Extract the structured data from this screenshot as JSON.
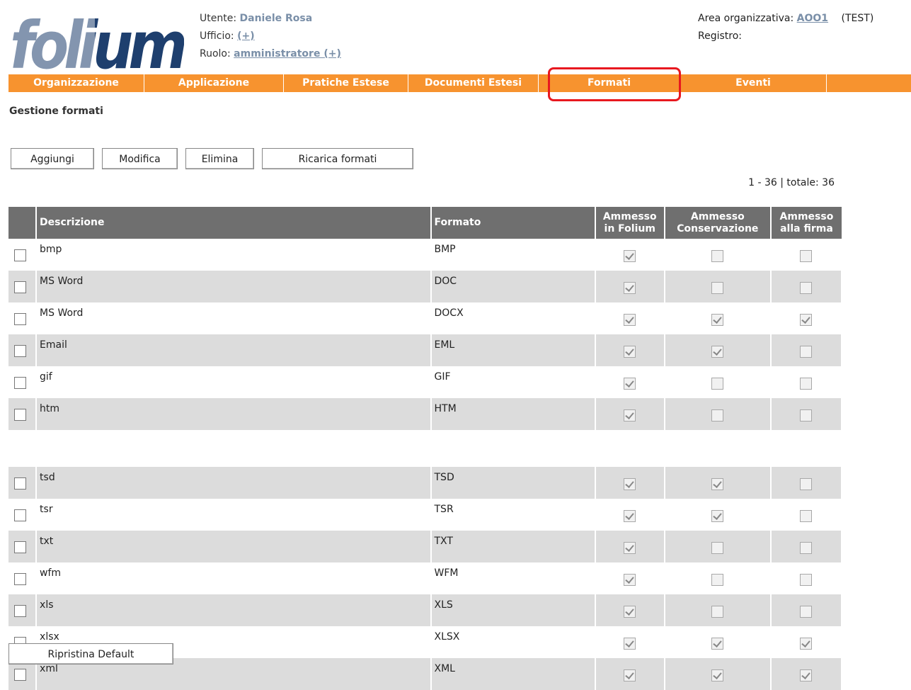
{
  "header": {
    "logo_text": "folium",
    "user_label": "Utente:",
    "user_name": "Daniele Rosa",
    "office_label": "Ufficio:",
    "office_link": "(+)",
    "role_label": "Ruolo:",
    "role_link": "amministratore (+)",
    "area_label": "Area organizzativa:",
    "area_link": "AOO1",
    "area_env": "(TEST)",
    "registry_label": "Registro:"
  },
  "nav": {
    "items": [
      "Organizzazione",
      "Applicazione",
      "Pratiche Estese",
      "Documenti Estesi",
      "Formati",
      "Eventi"
    ],
    "active": "Formati",
    "color": "#f7932f"
  },
  "page": {
    "title": "Gestione formati"
  },
  "toolbar": {
    "add": "Aggiungi",
    "edit": "Modifica",
    "delete": "Elimina",
    "reload": "Ricarica formati"
  },
  "pager": {
    "text": "1 - 36 | totale: 36"
  },
  "table": {
    "headers": {
      "description": "Descrizione",
      "format": "Formato",
      "folium_1": "Ammesso",
      "folium_2": "in Folium",
      "conservation_1": "Ammesso",
      "conservation_2": "Conservazione",
      "sign_1": "Ammesso",
      "sign_2": "alla firma"
    },
    "rows_top": [
      {
        "desc": "bmp",
        "format": "BMP",
        "folium": true,
        "conservation": false,
        "sign": false
      },
      {
        "desc": "MS Word",
        "format": "DOC",
        "folium": true,
        "conservation": false,
        "sign": false
      },
      {
        "desc": "MS Word",
        "format": "DOCX",
        "folium": true,
        "conservation": true,
        "sign": true
      },
      {
        "desc": "Email",
        "format": "EML",
        "folium": true,
        "conservation": true,
        "sign": false
      },
      {
        "desc": "gif",
        "format": "GIF",
        "folium": true,
        "conservation": false,
        "sign": false
      },
      {
        "desc": "htm",
        "format": "HTM",
        "folium": true,
        "conservation": false,
        "sign": false
      }
    ],
    "rows_bottom": [
      {
        "desc": "tsd",
        "format": "TSD",
        "folium": true,
        "conservation": true,
        "sign": false
      },
      {
        "desc": "tsr",
        "format": "TSR",
        "folium": true,
        "conservation": true,
        "sign": false
      },
      {
        "desc": "txt",
        "format": "TXT",
        "folium": true,
        "conservation": false,
        "sign": false
      },
      {
        "desc": "wfm",
        "format": "WFM",
        "folium": true,
        "conservation": false,
        "sign": false
      },
      {
        "desc": "xls",
        "format": "XLS",
        "folium": true,
        "conservation": false,
        "sign": false
      },
      {
        "desc": "xlsx",
        "format": "XLSX",
        "folium": true,
        "conservation": true,
        "sign": true
      },
      {
        "desc": "xml",
        "format": "XML",
        "folium": true,
        "conservation": true,
        "sign": true
      }
    ]
  },
  "footer": {
    "restore": "Ripristina Default"
  }
}
